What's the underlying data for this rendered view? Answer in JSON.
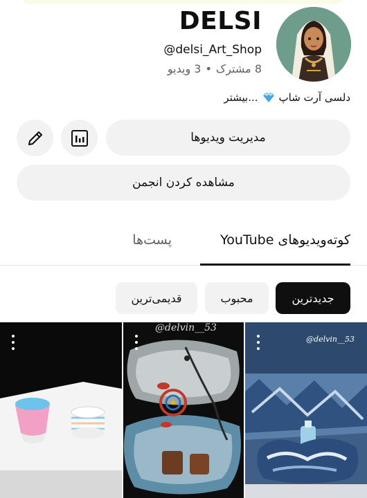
{
  "channel": {
    "name": "DELSI",
    "handle": "@delsi_Art_Shop",
    "subscribers": "8 مشترک",
    "videos": "3 ویدیو",
    "separator": "•",
    "description": "دلسی آرت شاپ",
    "more": "...بیشتر"
  },
  "actions": {
    "manage_videos": "مدیریت ویدیوها",
    "view_community": "مشاهده کردن انجمن"
  },
  "tabs": [
    {
      "label": "کوته‌ویدیوهای YouTube",
      "selected": true
    },
    {
      "label": "پست‌ها",
      "selected": false
    }
  ],
  "filters": [
    {
      "label": "جدیدترین",
      "selected": true
    },
    {
      "label": "محبوب",
      "selected": false
    },
    {
      "label": "قدیمی‌ترین",
      "selected": false
    }
  ],
  "shorts": [
    {
      "watermark": "",
      "icon": "more-vert-icon"
    },
    {
      "watermark": "@delvin__53",
      "icon": "more-vert-icon"
    },
    {
      "watermark": "@delvin__53",
      "icon": "more-vert-icon"
    }
  ],
  "colors": {
    "chip_selected": "#0f0f0f",
    "pill_bg": "#f2f2f2",
    "secondary_text": "#606060"
  }
}
